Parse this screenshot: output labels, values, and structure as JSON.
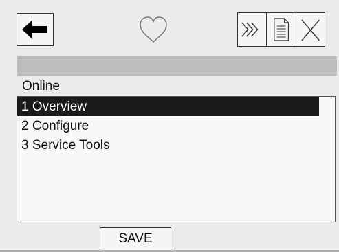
{
  "toolbar": {
    "back_icon": "arrow-left-icon",
    "favorite_icon": "heart-icon",
    "next_icon": "triple-chevron-right-icon",
    "document_icon": "document-icon",
    "close_icon": "close-icon"
  },
  "header": {
    "title": ""
  },
  "section": {
    "label": "Online"
  },
  "menu": {
    "selected_index": 0,
    "items": [
      {
        "label": "1 Overview"
      },
      {
        "label": "2 Configure"
      },
      {
        "label": "3 Service Tools"
      }
    ]
  },
  "footer": {
    "save_label": "SAVE"
  },
  "colors": {
    "background": "#ebebeb",
    "title_bar": "#bdbdbd",
    "selection": "#1a1a1a",
    "selection_text": "#ffffff"
  }
}
